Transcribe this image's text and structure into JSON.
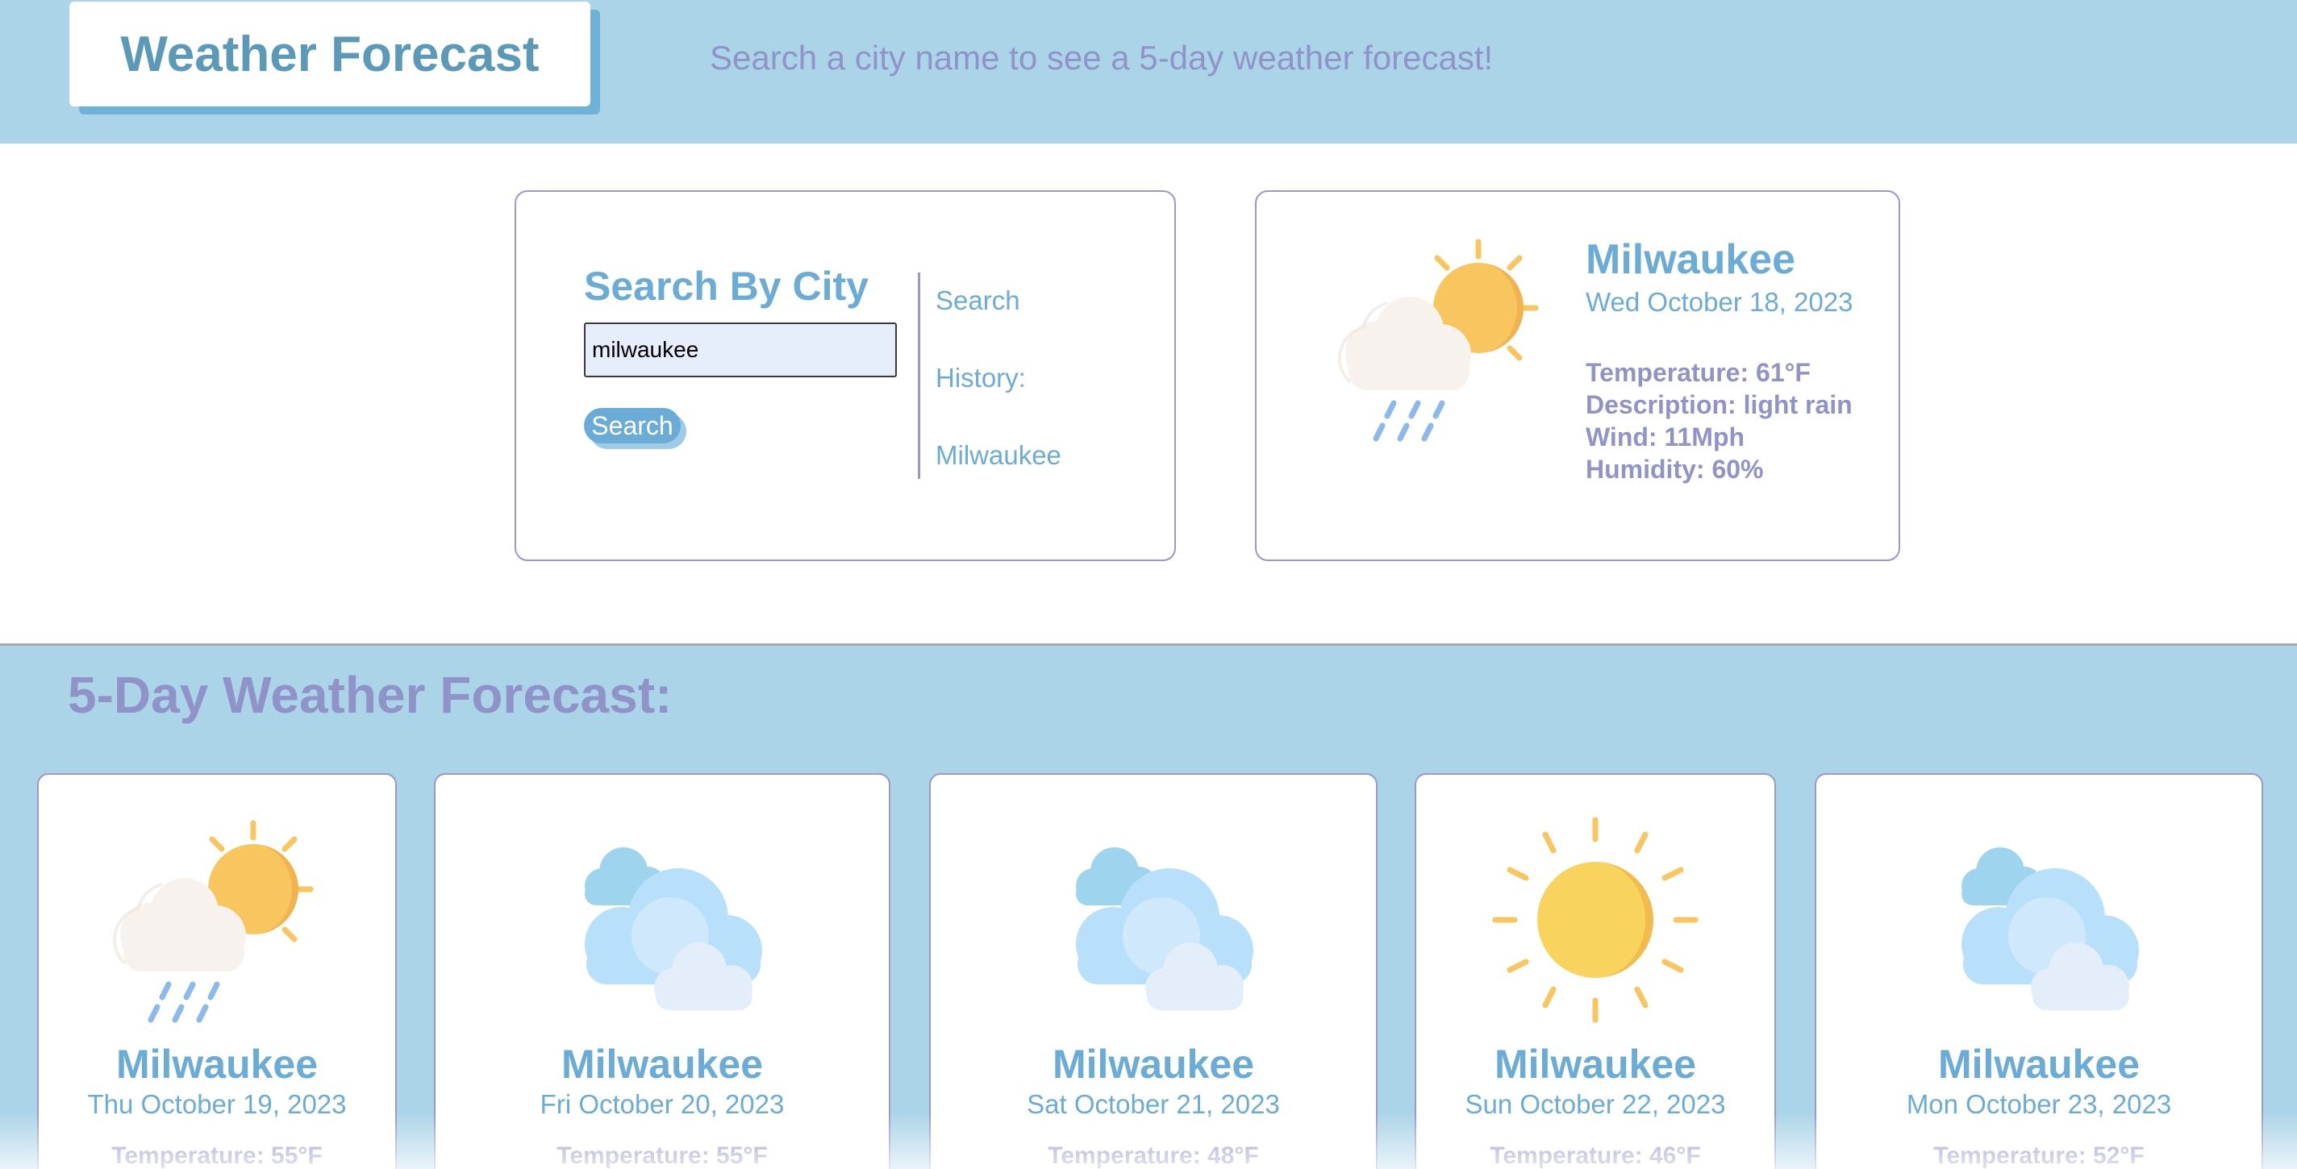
{
  "header": {
    "title": "Weather Forecast",
    "tagline": "Search a city name to see a 5-day weather forecast!"
  },
  "search": {
    "heading": "Search By City",
    "input_value": "milwaukee",
    "button_label": "Search",
    "history_label_1": "Search",
    "history_label_2": "History:",
    "history_items": [
      "Milwaukee"
    ]
  },
  "current": {
    "icon": "sun-cloud-rain-icon",
    "city": "Milwaukee",
    "date": "Wed October 18, 2023",
    "temperature": "Temperature: 61°F",
    "description": "Description: light rain",
    "wind": "Wind: 11Mph",
    "humidity": "Humidity: 60%"
  },
  "forecast": {
    "title": "5-Day Weather Forecast:",
    "days": [
      {
        "icon": "sun-cloud-rain-icon",
        "city": "Milwaukee",
        "date": "Thu October 19, 2023",
        "temperature": "Temperature: 55°F"
      },
      {
        "icon": "clouds-icon",
        "city": "Milwaukee",
        "date": "Fri October 20, 2023",
        "temperature": "Temperature: 55°F"
      },
      {
        "icon": "clouds-icon",
        "city": "Milwaukee",
        "date": "Sat October 21, 2023",
        "temperature": "Temperature: 48°F"
      },
      {
        "icon": "sun-icon",
        "city": "Milwaukee",
        "date": "Sun October 22, 2023",
        "temperature": "Temperature: 46°F"
      },
      {
        "icon": "clouds-icon",
        "city": "Milwaukee",
        "date": "Mon October 23, 2023",
        "temperature": "Temperature: 52°F"
      }
    ]
  },
  "colors": {
    "header_bg": "#acd4e8",
    "accent_blue": "#6aacd6",
    "accent_purple": "#9093c8",
    "title_blue": "#5a9ab8"
  }
}
